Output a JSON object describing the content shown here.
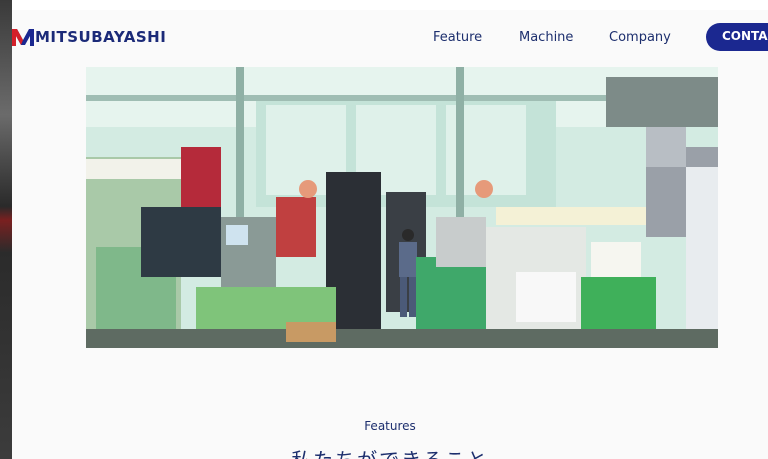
{
  "brand": {
    "name": "MITSUBAYASHI",
    "colors": {
      "primary": "#1b2890",
      "accent_red": "#d4202a",
      "text": "#1d2f6e"
    }
  },
  "nav": {
    "items": [
      {
        "label": "Feature"
      },
      {
        "label": "Machine"
      },
      {
        "label": "Company"
      }
    ],
    "contact_label": "CONTACT"
  },
  "hero": {
    "icon": "factory-floor-photo"
  },
  "features_section": {
    "label": "Features",
    "heading": "私たちができること"
  }
}
